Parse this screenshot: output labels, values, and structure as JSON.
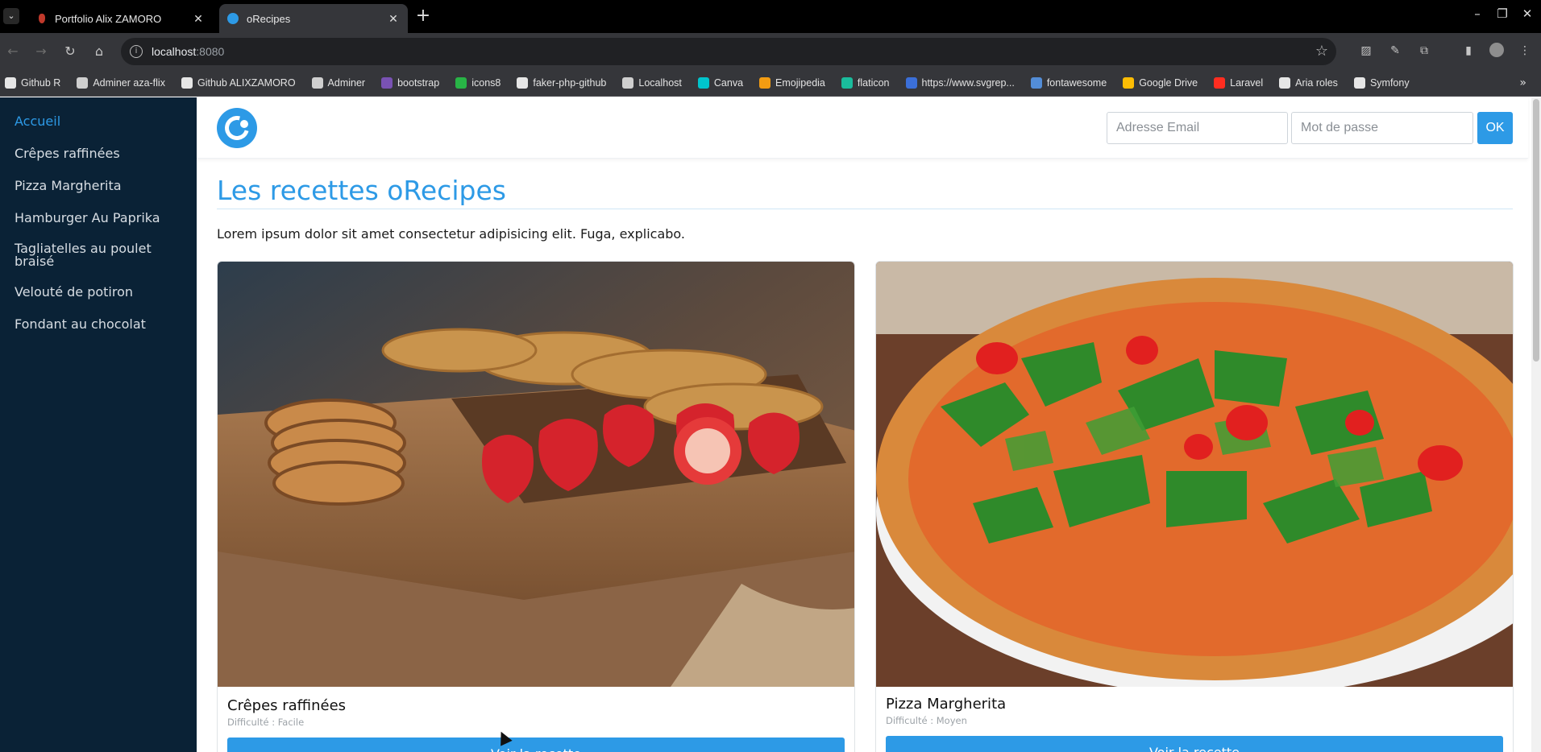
{
  "browser": {
    "tabs": [
      {
        "title": "Portfolio Alix ZAMORO",
        "active": false,
        "favicon_color": "#c0392b"
      },
      {
        "title": "oRecipes",
        "active": true,
        "favicon_color": "#2d9ae6"
      }
    ],
    "url": {
      "host": "localhost",
      "port": ":8080"
    },
    "bookmarks": [
      {
        "label": "Github R",
        "icon": "github-icon",
        "color": "#e6e6e6"
      },
      {
        "label": "Adminer aza-flix",
        "icon": "adminer-icon",
        "color": "#cfcfcf"
      },
      {
        "label": "Github ALIXZAMORO",
        "icon": "github-icon",
        "color": "#e6e6e6"
      },
      {
        "label": "Adminer",
        "icon": "adminer-icon",
        "color": "#cfcfcf"
      },
      {
        "label": "bootstrap",
        "icon": "bootstrap-icon",
        "color": "#7952b3"
      },
      {
        "label": "icons8",
        "icon": "icons8-icon",
        "color": "#28b446"
      },
      {
        "label": "faker-php-github",
        "icon": "github-icon",
        "color": "#e6e6e6"
      },
      {
        "label": "Localhost",
        "icon": "globe-icon",
        "color": "#cfcfcf"
      },
      {
        "label": "Canva",
        "icon": "canva-icon",
        "color": "#00c4cc"
      },
      {
        "label": "Emojipedia",
        "icon": "emojipedia-icon",
        "color": "#f39c12"
      },
      {
        "label": "flaticon",
        "icon": "flaticon-icon",
        "color": "#1abc9c"
      },
      {
        "label": "https://www.svgrep...",
        "icon": "svgrepo-icon",
        "color": "#3b6fd8"
      },
      {
        "label": "fontawesome",
        "icon": "flag-icon",
        "color": "#538dd7"
      },
      {
        "label": "Google Drive",
        "icon": "drive-icon",
        "color": "#fbbc04"
      },
      {
        "label": "Laravel",
        "icon": "laravel-icon",
        "color": "#ff2d20"
      },
      {
        "label": "Aria roles",
        "icon": "aria-icon",
        "color": "#e6e6e6"
      },
      {
        "label": "Symfony",
        "icon": "symfony-icon",
        "color": "#e6e6e6"
      }
    ]
  },
  "sidebar": {
    "items": [
      {
        "label": "Accueil",
        "active": true
      },
      {
        "label": "Crêpes raffinées",
        "active": false
      },
      {
        "label": "Pizza Margherita",
        "active": false
      },
      {
        "label": "Hamburger Au Paprika",
        "active": false
      },
      {
        "label": "Tagliatelles au poulet braisé",
        "active": false
      },
      {
        "label": "Velouté de potiron",
        "active": false
      },
      {
        "label": "Fondant au chocolat",
        "active": false
      }
    ]
  },
  "header": {
    "email_placeholder": "Adresse Email",
    "password_placeholder": "Mot de passe",
    "submit_label": "OK"
  },
  "main": {
    "title": "Les recettes oRecipes",
    "intro": "Lorem ipsum dolor sit amet consectetur adipisicing elit. Fuga, explicabo.",
    "recipes": [
      {
        "name": "Crêpes raffinées",
        "difficulty": "Difficulté : Facile",
        "button": "Voir la recette"
      },
      {
        "name": "Pizza Margherita",
        "difficulty": "Difficulté : Moyen",
        "button": "Voir la recette"
      }
    ]
  },
  "colors": {
    "accent": "#2d9ae6",
    "sidebar_bg": "#0a2236"
  }
}
